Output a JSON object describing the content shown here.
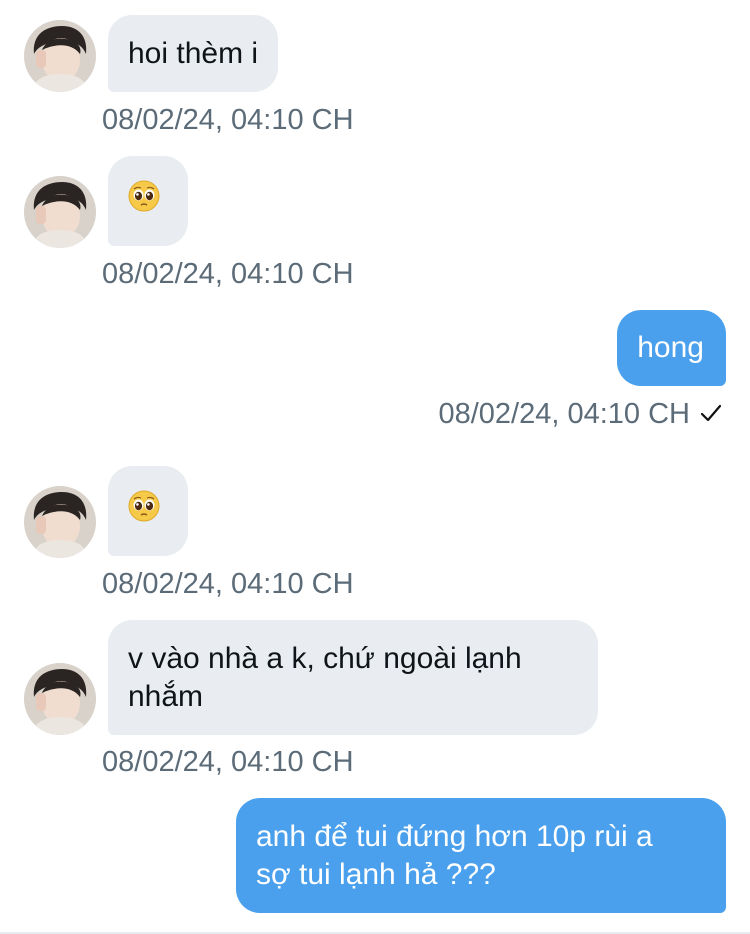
{
  "messages": [
    {
      "sender": "them",
      "text": "hoi thèm i",
      "time": "08/02/24, 04:10 CH"
    },
    {
      "sender": "them",
      "emoji": "pleading-face",
      "time": "08/02/24, 04:10 CH"
    },
    {
      "sender": "me",
      "text": "hong",
      "time": "08/02/24, 04:10 CH",
      "status": "✓"
    },
    {
      "sender": "them",
      "emoji": "pleading-face",
      "time": "08/02/24, 04:10 CH"
    },
    {
      "sender": "them",
      "line1": "v vào nhà a k, chứ ngoài lạnh",
      "line2": "nhắm",
      "time": "08/02/24, 04:10 CH"
    },
    {
      "sender": "me",
      "line1": "anh để tui đứng hơn 10p rùi a",
      "line2": "sợ tui lạnh hả ???"
    }
  ],
  "colors": {
    "incoming_bubble": "#e9edf1",
    "outgoing_bubble": "#4aa0ec",
    "timestamp": "#5b6b78"
  }
}
